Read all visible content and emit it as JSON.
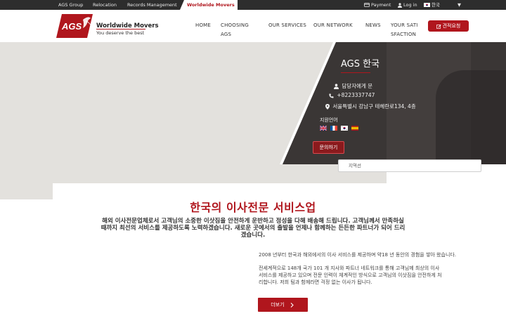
{
  "topbar": {
    "links": [
      "AGS Group",
      "Relocation",
      "Records Management"
    ],
    "active": "Worldwide Movers",
    "payment": "Payment",
    "login": "Log in",
    "language": "한국",
    "caret": "▼"
  },
  "header": {
    "logo_text": "AGS",
    "brand_name": "Worldwide Movers",
    "tagline": "You deserve the best",
    "nav": {
      "home": "HOME",
      "choosing": "CHOOSING AGS",
      "services": "OUR SERVICES",
      "network": "OUR NETWORK",
      "news": "NEWS",
      "satisfaction": "YOUR SATISFACTION"
    },
    "quote_button": "견적요청"
  },
  "office": {
    "title": "AGS 한국",
    "contact_person": "담당자에게 문",
    "phone": "+8223337747",
    "address": "서울특별시 강남구 테헤란로134, 4층",
    "language_label": "지원언어",
    "contact_button": "문의하기",
    "select_placeholder": "지역선"
  },
  "main": {
    "title": "한국의 이사전문 서비스업",
    "description": "해외 이사전문업체로서 고객님의 소중한 이삿짐을 안전하게 운반하고 정성을 다해 배송해 드립니다. 고객님께서 만족하실 때까지 최선의 서비스를 제공하도록 노력하겠습니다. 새로운 곳에서의 출발을 언제나 함께하는 든든한 파트너가 되어 드리겠습니다.",
    "paragraph1": "2008 년부터 한국과 해외에서의 이사 서비스를 제공하며 약18 년 동안의 경험을 쌓아 왔습니다.",
    "paragraph2": "전세계적으로 148개 국가 101 개 지사와 파트너 네트워크를 통해 고객님께 최상의 이사 서비스를 제공하고 있으며 전문 인력이 체계적인 방식으로 고객님의 이삿짐을 안전하게 처리합니다. 저희 팀과 함께라면 걱정 없는 이사가 됩니다.",
    "more_button": "더보기"
  },
  "colors": {
    "accent": "#b0161d",
    "topbar": "#2d2d2d",
    "panel": "#3a3635",
    "map": "#e3e1dd"
  }
}
